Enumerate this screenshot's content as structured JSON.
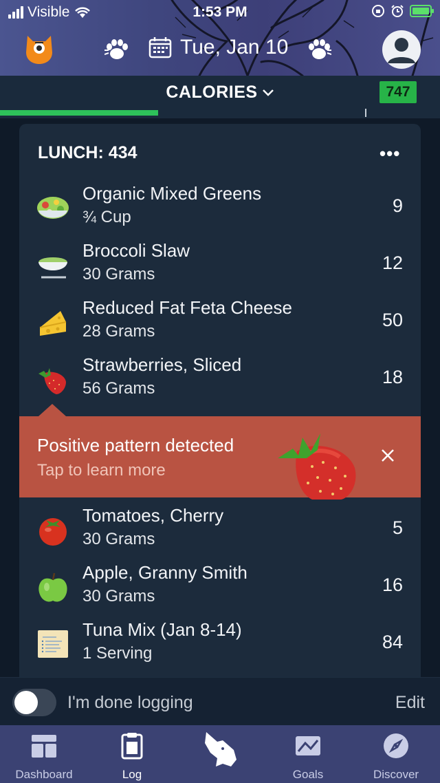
{
  "status_bar": {
    "carrier": "Visible",
    "time": "1:53 PM"
  },
  "header": {
    "date": "Tue, Jan 10"
  },
  "calories_bar": {
    "label": "CALORIES",
    "badge": "747",
    "progress_fraction": 0.36,
    "accent_color": "#2ec15a"
  },
  "meal": {
    "title": "LUNCH: 434",
    "more_label": "•••",
    "items": [
      {
        "name": "Organic Mixed Greens",
        "amount": "¾ Cup",
        "calories": "9",
        "icon": "salad-icon"
      },
      {
        "name": "Broccoli Slaw",
        "amount": "30 Grams",
        "calories": "12",
        "icon": "slaw-bowl-icon"
      },
      {
        "name": "Reduced Fat Feta Cheese",
        "amount": "28 Grams",
        "calories": "50",
        "icon": "cheese-icon"
      },
      {
        "name": "Strawberries, Sliced",
        "amount": "56 Grams",
        "calories": "18",
        "icon": "strawberry-icon"
      },
      {
        "name": "Tomatoes, Cherry",
        "amount": "30 Grams",
        "calories": "5",
        "icon": "tomato-icon"
      },
      {
        "name": "Apple, Granny Smith",
        "amount": "30 Grams",
        "calories": "16",
        "icon": "green-apple-icon"
      },
      {
        "name": "Tuna Mix (Jan 8-14)",
        "amount": "1 Serving",
        "calories": "84",
        "icon": "recipe-card-icon"
      }
    ]
  },
  "banner": {
    "title": "Positive pattern detected",
    "subtitle": "Tap to learn more",
    "color": "#b95342"
  },
  "done_bar": {
    "label": "I'm done logging",
    "edit_label": "Edit",
    "toggle_on": false
  },
  "tabs": [
    {
      "label": "Dashboard",
      "icon": "dashboard-icon"
    },
    {
      "label": "Log",
      "icon": "log-icon"
    },
    {
      "label": "",
      "icon": "wolf-icon"
    },
    {
      "label": "Goals",
      "icon": "goals-icon"
    },
    {
      "label": "Discover",
      "icon": "compass-icon"
    }
  ]
}
